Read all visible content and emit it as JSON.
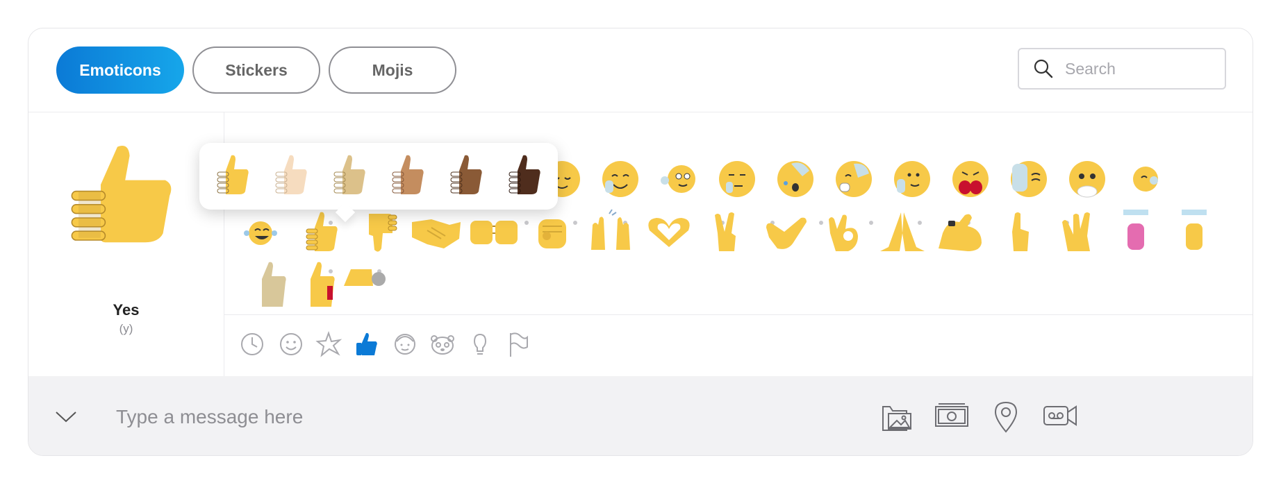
{
  "tabs": [
    {
      "label": "Emoticons",
      "active": true
    },
    {
      "label": "Stickers",
      "active": false
    },
    {
      "label": "Mojis",
      "active": false
    }
  ],
  "search": {
    "placeholder": "Search"
  },
  "preview": {
    "name": "Yes",
    "code": "(y)"
  },
  "skin_tones": [
    "#f7c948",
    "#f6dcbf",
    "#dcc18a",
    "#c48d5f",
    "#8a5a36",
    "#4f2d1d"
  ],
  "categories": [
    {
      "icon": "clock-icon",
      "active": false
    },
    {
      "icon": "smiley-icon",
      "active": false
    },
    {
      "icon": "star-burst-icon",
      "active": false
    },
    {
      "icon": "thumbs-up-icon",
      "active": true
    },
    {
      "icon": "person-icon",
      "active": false
    },
    {
      "icon": "animal-icon",
      "active": false
    },
    {
      "icon": "lightbulb-icon",
      "active": false
    },
    {
      "icon": "flag-icon",
      "active": false
    }
  ],
  "composer": {
    "placeholder": "Type a message here"
  },
  "colors": {
    "accent": "#0b7ad6",
    "emoji_yellow": "#f7c948",
    "icon_gray": "#a9a9ae"
  }
}
